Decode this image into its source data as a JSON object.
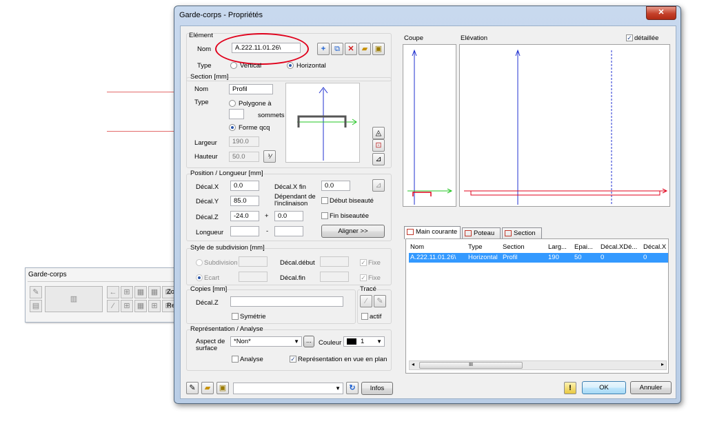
{
  "background_window": {
    "title": "Garde-corps",
    "label_zo": "Zo",
    "label_re": "Re"
  },
  "dialog": {
    "title": "Garde-corps - Propriétés",
    "close_icon": "close-icon"
  },
  "element": {
    "group_label": "Elément",
    "nom_label": "Nom",
    "nom_value": "A.222.11.01.26\\",
    "type_label": "Type",
    "type_options": [
      "Vertical",
      "Horizontal"
    ],
    "type_selected": "Horizontal"
  },
  "section": {
    "group_label": "Section  [mm]",
    "nom_label": "Nom",
    "nom_value": "Profil",
    "type_label": "Type",
    "polygon_label": "Polygone à",
    "sommets_label": "sommets",
    "forme_label": "Forme qcq",
    "largeur_label": "Largeur",
    "largeur_value": "190.0",
    "hauteur_label": "Hauteur",
    "hauteur_value": "50.0"
  },
  "position": {
    "group_label": "Position / Longueur [mm]",
    "decal_x_label": "Décal.X",
    "decal_x_value": "0.0",
    "decal_x_fin_label": "Décal.X fin",
    "decal_x_fin_value": "0.0",
    "decal_y_label": "Décal.Y",
    "decal_y_value": "85.0",
    "dependant_label_1": "Dépendant de",
    "dependant_label_2": "l'inclinaison",
    "debut_biseaute_label": "Début biseauté",
    "decal_z_label": "Décal.Z",
    "decal_z_value": "-24.0",
    "plus_sign": "+",
    "decal_z_extra": "0.0",
    "fin_biseautee_label": "Fin biseautée",
    "longueur_label": "Longueur",
    "minus_sign": "-",
    "aligner_label": "Aligner >>"
  },
  "subdivision": {
    "group_label": "Style de subdivision [mm]",
    "subdivision_label": "Subdivision",
    "ecart_label": "Ecart",
    "decal_debut_label": "Décal.début",
    "decal_fin_label": "Décal.fin",
    "fixe_label": "Fixe"
  },
  "copies": {
    "group_label": "Copies  [mm]",
    "decal_z_label": "Décal.Z",
    "symetrie_label": "Symétrie"
  },
  "trace": {
    "group_label": "Tracé",
    "actif_label": "actif"
  },
  "representation": {
    "group_label": "Représentation / Analyse",
    "aspect_label_1": "Aspect de",
    "aspect_label_2": "surface",
    "aspect_value": "*Non*",
    "ellipsis_label": "...",
    "couleur_label": "Couleur",
    "couleur_value": "1",
    "analyse_label": "Analyse",
    "plan_label": "Représentation en vue en plan"
  },
  "views": {
    "coupe_label": "Coupe",
    "elevation_label": "Elévation",
    "detaillee_label": "détaillée"
  },
  "tabs": [
    "Main courante",
    "Poteau",
    "Section"
  ],
  "table": {
    "headers": [
      "Nom",
      "Type",
      "Section",
      "Larg...",
      "Epai...",
      "Décal.XDé...",
      "Décal.X"
    ],
    "rows": [
      [
        "A.222.11.01.26\\",
        "Horizontal",
        "Profil",
        "190",
        "50",
        "0",
        "0"
      ]
    ],
    "scroll_mid": "III"
  },
  "footer": {
    "infos_label": "Infos",
    "info_icon_glyph": "!",
    "ok_label": "OK",
    "annuler_label": "Annuler"
  },
  "colors": {
    "selection": "#3399ff",
    "annotation_red": "#e0001b",
    "axis_blue": "#1f2fd0",
    "axis_green": "#22c422"
  }
}
